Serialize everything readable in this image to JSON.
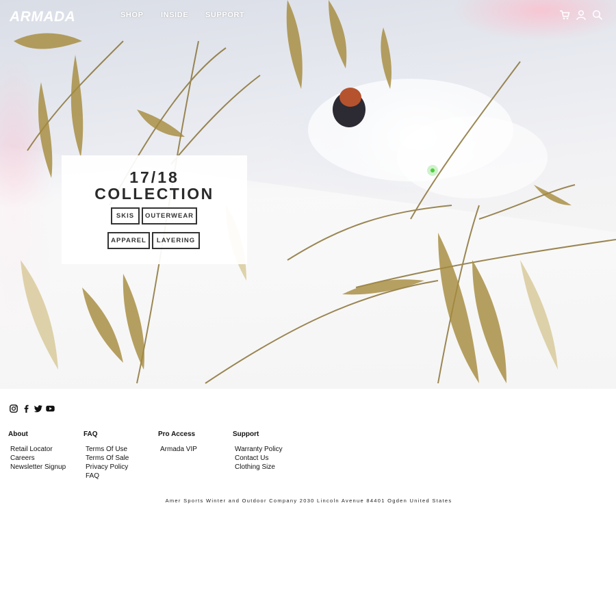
{
  "brand": {
    "name": "ARMADA"
  },
  "nav": {
    "links": [
      "SHOP",
      "INSIDE",
      "SUPPORT"
    ],
    "icons": [
      "cart-icon",
      "user-icon",
      "search-icon"
    ]
  },
  "collection": {
    "year": "17/18",
    "title": "COLLECTION",
    "buttons": [
      "SKIS",
      "OUTERWEAR",
      "APPAREL",
      "LAYERING"
    ]
  },
  "footer": {
    "social": [
      "instagram-icon",
      "facebook-icon",
      "twitter-icon",
      "youtube-icon"
    ],
    "columns": [
      {
        "title": "About",
        "links": [
          "Retail Locator",
          "Careers",
          "Newsletter Signup"
        ]
      },
      {
        "title": "FAQ",
        "links": [
          "Terms Of Use",
          "Terms Of Sale",
          "Privacy Policy",
          "FAQ"
        ]
      },
      {
        "title": "Pro Access",
        "links": [
          "Armada VIP"
        ]
      },
      {
        "title": "Support",
        "links": [
          "Warranty Policy",
          "Contact Us",
          "Clothing Size"
        ]
      }
    ],
    "address": "Amer Sports Winter and Outdoor Company 2030 Lincoln Avenue 84401 Ogden United States"
  },
  "colors": {
    "text": "#222222",
    "accent_cursor": "#4ccf3a",
    "background": "#ffffff"
  }
}
